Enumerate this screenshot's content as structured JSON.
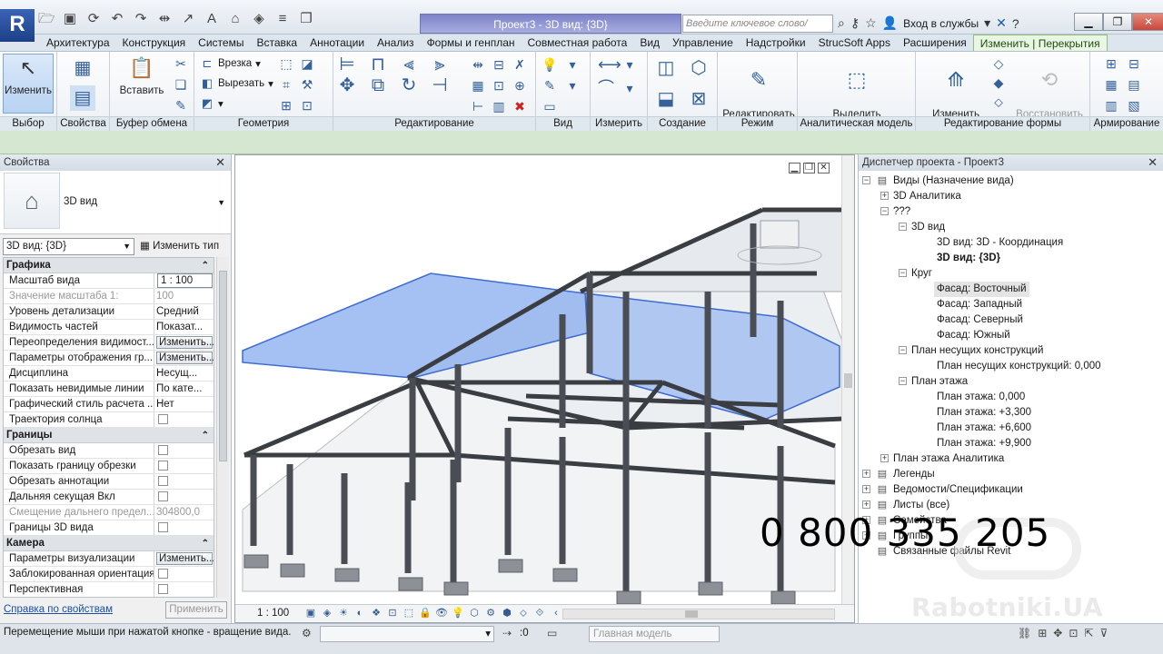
{
  "app": {
    "logo": "R",
    "title": "Проект3 - 3D вид: {3D}",
    "search_placeholder": "Введите ключевое слово/фразу",
    "signin": "Вход в службы",
    "qat_icons": [
      "open-icon",
      "save-icon",
      "sync-icon",
      "undo-icon",
      "redo-icon",
      "measure-icon",
      "dimension-icon",
      "text-icon",
      "3d-view-icon",
      "section-icon",
      "thin-lines-icon",
      "switch-windows-icon"
    ]
  },
  "tabs": [
    {
      "label": "Архитектура",
      "active": false
    },
    {
      "label": "Конструкция",
      "active": false
    },
    {
      "label": "Системы",
      "active": false
    },
    {
      "label": "Вставка",
      "active": false
    },
    {
      "label": "Аннотации",
      "active": false
    },
    {
      "label": "Анализ",
      "active": false
    },
    {
      "label": "Формы и генплан",
      "active": false
    },
    {
      "label": "Совместная работа",
      "active": false
    },
    {
      "label": "Вид",
      "active": false
    },
    {
      "label": "Управление",
      "active": false
    },
    {
      "label": "Надстройки",
      "active": false
    },
    {
      "label": "StrucSoft Apps",
      "active": false
    },
    {
      "label": "Расширения",
      "active": false
    },
    {
      "label": "Изменить | Перекрытия",
      "active": true
    }
  ],
  "ribbon": {
    "modify": "Изменить",
    "paste": "Вставить",
    "cut_cope": "Врезка",
    "cut": "Вырезать",
    "edit_boundary": "Редактировать\nграницу",
    "select_analytical": "Выделить\nаналитическую модель",
    "modify_subelements": "Изменить\nсубэлементы",
    "reset_shape": "Восстановить\nформу",
    "panels": {
      "select": "Выбор",
      "properties": "Свойства",
      "clipboard": "Буфер обмена",
      "geometry": "Геометрия",
      "modify": "Редактирование",
      "view": "Вид",
      "measure": "Измерить",
      "create": "Создание",
      "mode": "Режим",
      "analytical": "Аналитическая модель",
      "shape_editing": "Редактирование формы",
      "reinforcement": "Армирование"
    }
  },
  "properties": {
    "title": "Свойства",
    "type_name": "3D вид",
    "instance": "3D вид: {3D}",
    "edit_type": "Изменить тип",
    "groups": [
      {
        "label": "Графика",
        "rows": [
          {
            "key": "Масштаб вида",
            "value": "1 : 100",
            "kind": "input"
          },
          {
            "key": "Значение масштаба    1:",
            "value": "100",
            "kind": "disabled"
          },
          {
            "key": "Уровень детализации",
            "value": "Средний",
            "kind": "text"
          },
          {
            "key": "Видимость частей",
            "value": "Показат...",
            "kind": "text"
          },
          {
            "key": "Переопределения видимост...",
            "value": "Изменить...",
            "kind": "button"
          },
          {
            "key": "Параметры отображения гр...",
            "value": "Изменить...",
            "kind": "button"
          },
          {
            "key": "Дисциплина",
            "value": "Несущ...",
            "kind": "text"
          },
          {
            "key": "Показать невидимые линии",
            "value": "По кате...",
            "kind": "text"
          },
          {
            "key": "Графический стиль расчета ...",
            "value": "Нет",
            "kind": "text"
          },
          {
            "key": "Траектория солнца",
            "value": "",
            "kind": "checkbox"
          }
        ]
      },
      {
        "label": "Границы",
        "rows": [
          {
            "key": "Обрезать вид",
            "value": "",
            "kind": "checkbox"
          },
          {
            "key": "Показать границу обрезки",
            "value": "",
            "kind": "checkbox"
          },
          {
            "key": "Обрезать аннотации",
            "value": "",
            "kind": "checkbox"
          },
          {
            "key": "Дальняя секущая Вкл",
            "value": "",
            "kind": "checkbox"
          },
          {
            "key": "Смещение дальнего предел...",
            "value": "304800,0",
            "kind": "disabled"
          },
          {
            "key": "Границы 3D вида",
            "value": "",
            "kind": "checkbox"
          }
        ]
      },
      {
        "label": "Камера",
        "rows": [
          {
            "key": "Параметры визуализации",
            "value": "Изменить...",
            "kind": "button"
          },
          {
            "key": "Заблокированная ориентация",
            "value": "",
            "kind": "checkbox"
          },
          {
            "key": "Перспективная",
            "value": "",
            "kind": "checkbox"
          }
        ]
      }
    ],
    "help_link": "Справка по свойствам",
    "apply": "Применить"
  },
  "view": {
    "scale": "1 : 100"
  },
  "browser": {
    "title": "Диспетчер проекта - Проект3",
    "nodes": [
      {
        "label": "Виды (Назначение вида)",
        "level": 0,
        "toggle": "−",
        "icon": "views-icon"
      },
      {
        "label": "3D Аналитика",
        "level": 1,
        "toggle": "+"
      },
      {
        "label": "???",
        "level": 1,
        "toggle": "−"
      },
      {
        "label": "3D вид",
        "level": 2,
        "toggle": "−"
      },
      {
        "label": "3D вид: 3D - Координация",
        "level": 3
      },
      {
        "label": "3D вид: {3D}",
        "level": 3,
        "bold": true
      },
      {
        "label": "Круг",
        "level": 2,
        "toggle": "−"
      },
      {
        "label": "Фасад: Восточный",
        "level": 3,
        "selected": true
      },
      {
        "label": "Фасад: Западный",
        "level": 3
      },
      {
        "label": "Фасад: Северный",
        "level": 3
      },
      {
        "label": "Фасад: Южный",
        "level": 3
      },
      {
        "label": "План несущих конструкций",
        "level": 2,
        "toggle": "−"
      },
      {
        "label": "План несущих конструкций: 0,000",
        "level": 3
      },
      {
        "label": "План этажа",
        "level": 2,
        "toggle": "−"
      },
      {
        "label": "План этажа: 0,000",
        "level": 3
      },
      {
        "label": "План этажа: +3,300",
        "level": 3
      },
      {
        "label": "План этажа: +6,600",
        "level": 3
      },
      {
        "label": "План этажа: +9,900",
        "level": 3
      },
      {
        "label": "План этажа Аналитика",
        "level": 1,
        "toggle": "+"
      },
      {
        "label": "Легенды",
        "level": 0,
        "toggle": "+",
        "icon": "legend-icon"
      },
      {
        "label": "Ведомости/Спецификации",
        "level": 0,
        "toggle": "+",
        "icon": "schedule-icon"
      },
      {
        "label": "Листы (все)",
        "level": 0,
        "toggle": "+",
        "icon": "sheets-icon"
      },
      {
        "label": "Семейства",
        "level": 0,
        "toggle": "+",
        "icon": "families-icon"
      },
      {
        "label": "Группы",
        "level": 0,
        "toggle": "+",
        "icon": "groups-icon"
      },
      {
        "label": "Связанные файлы Revit",
        "level": 0,
        "icon": "links-icon"
      }
    ]
  },
  "overlay": {
    "phone": "0 800 335 205",
    "watermark": "Rabotniki.UA"
  },
  "status": {
    "message": "Перемещение мыши при нажатой кнопке - вращение вида.",
    "worksets": ":0",
    "model": "Главная модель"
  },
  "colors": {
    "accent": "#9cc68e",
    "selection": "#6f9ae8",
    "active_tab": "#e9f6e4"
  }
}
